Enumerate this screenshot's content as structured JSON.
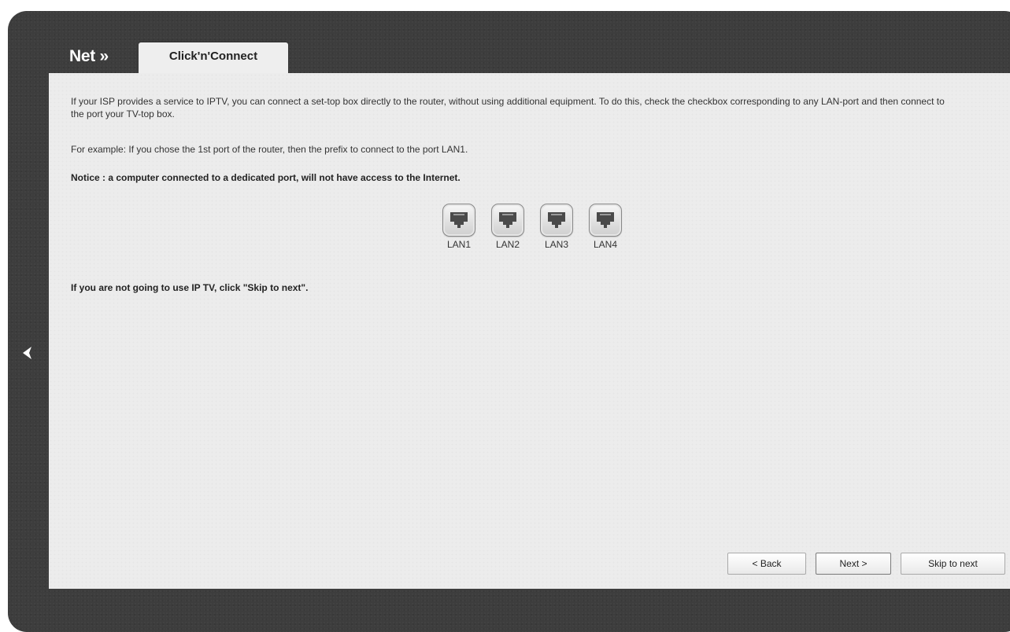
{
  "header": {
    "breadcrumb": "Net »",
    "tab_label": "Click'n'Connect"
  },
  "content": {
    "intro": "If your ISP provides a service to IPTV, you can connect a set-top box directly to the router, without using additional equipment. To do this, check the checkbox corresponding to any LAN-port and then connect to the port your TV-top box.",
    "example": "For example: If you chose the 1st port of the router, then the prefix to connect to the port LAN1.",
    "notice": "Notice : a computer connected to a dedicated port, will not have access to the Internet.",
    "skip_note": "If you are not going to use IP TV, click \"Skip to next\".",
    "ports": [
      {
        "label": "LAN1",
        "icon": "ethernet-port-icon"
      },
      {
        "label": "LAN2",
        "icon": "ethernet-port-icon"
      },
      {
        "label": "LAN3",
        "icon": "ethernet-port-icon"
      },
      {
        "label": "LAN4",
        "icon": "ethernet-port-icon"
      }
    ]
  },
  "buttons": {
    "back": "< Back",
    "next": "Next >",
    "skip": "Skip to next"
  },
  "nav": {
    "left_arrow_icon": "chevron-left-icon"
  },
  "colors": {
    "frame": "#3d3d3d",
    "panel": "#ececec",
    "text": "#333333"
  }
}
